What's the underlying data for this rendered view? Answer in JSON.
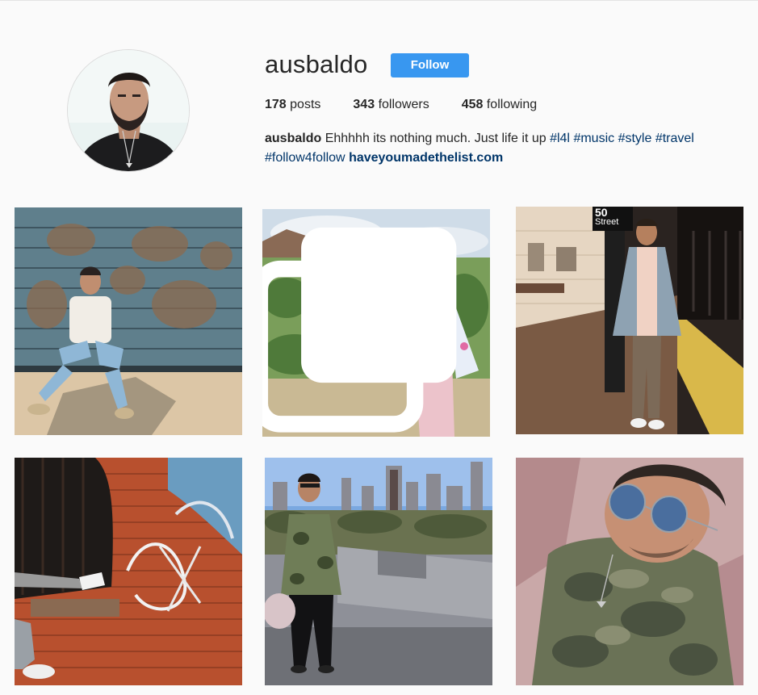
{
  "profile": {
    "username": "ausbaldo",
    "follow_label": "Follow",
    "posts_count": "178",
    "posts_label": "posts",
    "followers_count": "343",
    "followers_label": "followers",
    "following_count": "458",
    "following_label": "following",
    "bio_name": "ausbaldo",
    "bio_text": "Ehhhhh its nothing much. Just life it up",
    "bio_tags": [
      "#l4l",
      "#music",
      "#style",
      "#travel",
      "#follow4follow"
    ],
    "bio_link": "haveyoumadethelist.com"
  },
  "posts": [
    {
      "id": "post-1",
      "multiple": false
    },
    {
      "id": "post-2",
      "multiple": true
    },
    {
      "id": "post-3",
      "multiple": false
    },
    {
      "id": "post-4",
      "multiple": false
    },
    {
      "id": "post-5",
      "multiple": false
    },
    {
      "id": "post-6",
      "multiple": false
    }
  ],
  "post3_sign": "Street",
  "post3_sign_num": "50",
  "colors": {
    "follow": "#3897f0",
    "hashtag": "#003569"
  }
}
